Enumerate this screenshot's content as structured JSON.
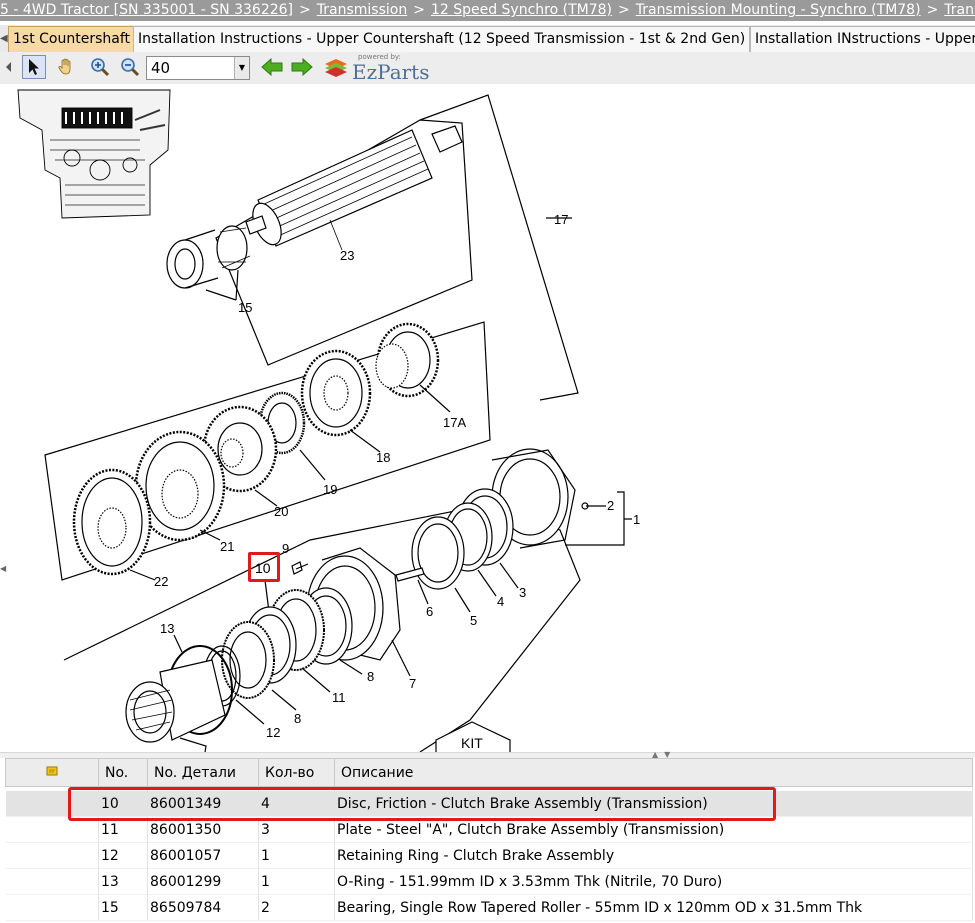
{
  "breadcrumb": {
    "items": [
      "5 - 4WD Tractor [SN 335001 - SN 336226]",
      "Transmission",
      "12 Speed Synchro (TM78)",
      "Transmission Mounting - Synchro (TM78)",
      "Trans"
    ],
    "separator": ">"
  },
  "tabs": [
    {
      "label": "1st Countershaft",
      "active": true
    },
    {
      "label": "Installation Instructions - Upper Countershaft (12 Speed Transmission - 1st & 2nd Gen)",
      "active": false
    },
    {
      "label": "Installation INstructions - Upper",
      "active": false
    }
  ],
  "toolbar": {
    "zoom_value": "40",
    "zoom_dropdown_icon": "▼",
    "logo_text": "EzParts",
    "logo_caption": "powered by:"
  },
  "icons": {
    "pointer": "pointer-icon",
    "hand": "hand-pan-icon",
    "zoom_in": "zoom-in-icon",
    "zoom_out": "zoom-out-icon",
    "back": "arrow-left-icon",
    "forward": "arrow-right-icon",
    "tab_scroll": "chevron-left-icon",
    "notes_header": "note-icon"
  },
  "colors": {
    "highlight": "#e01919",
    "active_tab": "#f6d9a5",
    "nav_arrow": "#4cae1f",
    "logo": "#4e6f92"
  },
  "diagram": {
    "callouts": [
      "17",
      "23",
      "15",
      "17A",
      "18",
      "19",
      "20",
      "21",
      "22",
      "2",
      "1",
      "9",
      "10",
      "3",
      "4",
      "5",
      "6",
      "13",
      "7",
      "8",
      "11",
      "12",
      "8"
    ],
    "kit_label": "KIT"
  },
  "parts_table": {
    "headers": [
      "",
      "No.",
      "No. Детали",
      "Кол-во",
      "Описание"
    ],
    "rows": [
      {
        "no": "10",
        "part": "86001349",
        "qty": "4",
        "desc": "Disc, Friction - Clutch Brake Assembly (Transmission)",
        "selected": true
      },
      {
        "no": "11",
        "part": "86001350",
        "qty": "3",
        "desc": "Plate - Steel \"A\", Clutch Brake Assembly (Transmission)",
        "selected": false
      },
      {
        "no": "12",
        "part": "86001057",
        "qty": "1",
        "desc": "Retaining Ring - Clutch Brake Assembly",
        "selected": false
      },
      {
        "no": "13",
        "part": "86001299",
        "qty": "1",
        "desc": "O-Ring - 151.99mm ID x 3.53mm Thk (Nitrile, 70 Duro)",
        "selected": false
      },
      {
        "no": "15",
        "part": "86509784",
        "qty": "2",
        "desc": "Bearing, Single Row Tapered Roller - 55mm ID x 120mm OD x 31.5mm Thk",
        "selected": false
      }
    ]
  }
}
